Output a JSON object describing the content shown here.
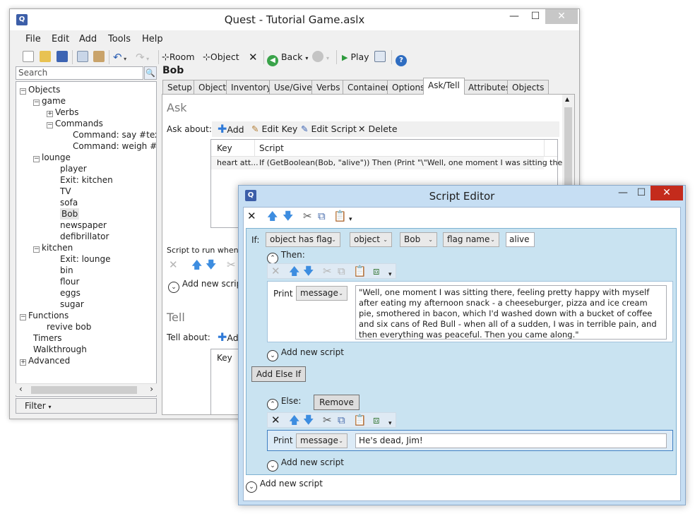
{
  "main_window": {
    "title": "Quest - Tutorial Game.aslx",
    "minimize": "—",
    "maximize": "☐",
    "close": "✕"
  },
  "menu": [
    "File",
    "Edit",
    "Add",
    "Tools",
    "Help"
  ],
  "toolbar": {
    "room_label": "Room",
    "object_label": "Object",
    "back_label": "Back",
    "play_label": "Play"
  },
  "search": {
    "placeholder": "Search"
  },
  "tree": {
    "objects": "Objects",
    "game": "game",
    "verbs": "Verbs",
    "commands": "Commands",
    "cmd_say": "Command: say #text#",
    "cmd_weigh": "Command: weigh #object",
    "lounge": "lounge",
    "player": "player",
    "exit_kitchen": "Exit: kitchen",
    "tv": "TV",
    "sofa": "sofa",
    "bob": "Bob",
    "newspaper": "newspaper",
    "defibrillator": "defibrillator",
    "kitchen": "kitchen",
    "exit_lounge": "Exit: lounge",
    "bin": "bin",
    "flour": "flour",
    "eggs": "eggs",
    "sugar": "sugar",
    "functions": "Functions",
    "revive_bob": "revive bob",
    "timers": "Timers",
    "walkthrough": "Walkthrough",
    "advanced": "Advanced"
  },
  "filter_label": "Filter",
  "object_name": "Bob",
  "tabs": [
    "Setup",
    "Object",
    "Inventory",
    "Use/Give",
    "Verbs",
    "Container",
    "Options",
    "Ask/Tell",
    "Attributes",
    "Objects"
  ],
  "selected_tab": "Ask/Tell",
  "ask": {
    "title": "Ask",
    "about_label": "Ask about:",
    "add": "Add",
    "edit_key": "Edit Key",
    "edit_script": "Edit Script",
    "delete": "Delete",
    "col_key": "Key",
    "col_script": "Script",
    "row_key": "heart att...",
    "row_script": "If (GetBoolean(Bob, \"alive\")) Then (Print \"\\\"Well, one moment I was sitting there, f...",
    "script_to_run": "Script to run when ask",
    "add_new_script": "Add new script"
  },
  "tell": {
    "title": "Tell",
    "about_label": "Tell about:",
    "add_partial": "Ad",
    "col_key": "Key"
  },
  "script_editor": {
    "title": "Script Editor",
    "if_label": "If:",
    "cond_type": "object has flag",
    "cond_kind": "object",
    "cond_object": "Bob",
    "cond_flag_kind": "flag name",
    "cond_flag": "alive",
    "then_label": "Then:",
    "print_label": "Print",
    "print_type": "message",
    "then_message": "\"Well, one moment I was sitting there, feeling pretty happy with myself after eating my afternoon snack - a cheeseburger, pizza and ice cream pie, smothered in bacon, which I'd washed down with a bucket of coffee and six cans of Red Bull - when all of a sudden, I was in terrible pain, and then everything was peaceful. Then you came along.\"",
    "add_new_script": "Add new script",
    "add_else_if": "Add Else If",
    "else_label": "Else:",
    "remove": "Remove",
    "else_message": "He's dead, Jim!"
  }
}
